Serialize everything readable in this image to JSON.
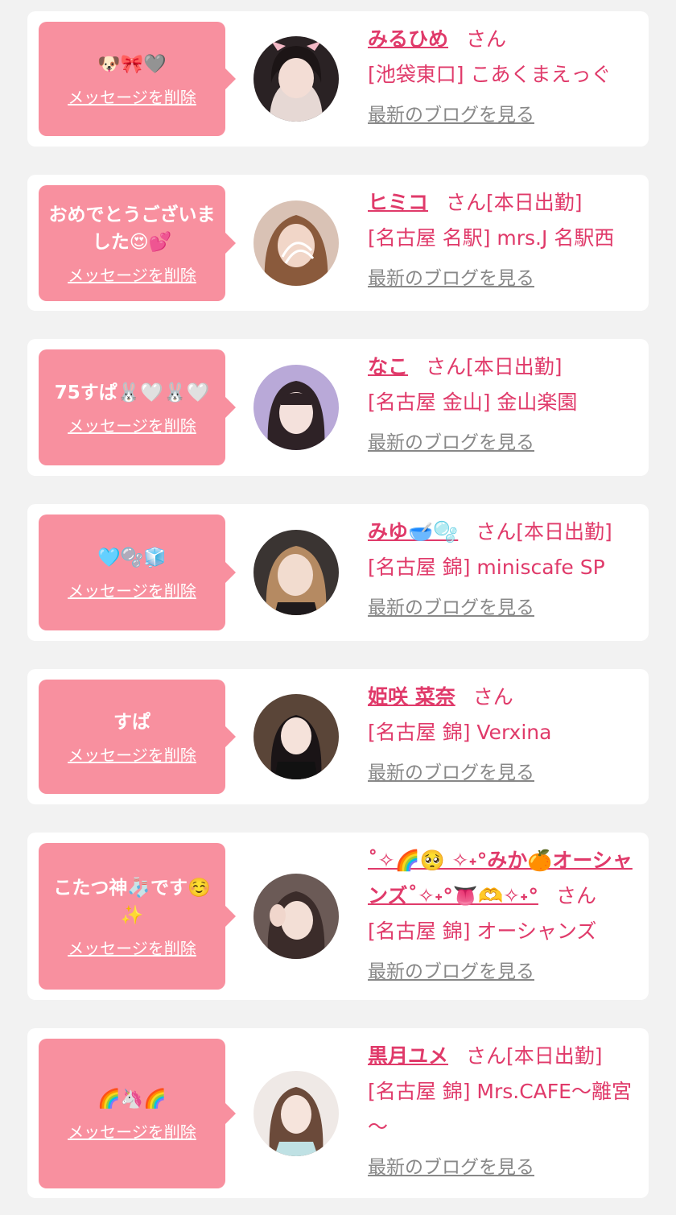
{
  "items": [
    {
      "message": "🐶🎀🩶",
      "delete_label": "メッセージを削除",
      "name": "みるひめ",
      "honorific": "さん",
      "work_status": "",
      "shop": "[池袋東口] こあくまえっぐ",
      "blog_label": "最新のブログを見る"
    },
    {
      "message": "おめでとうございました😍💕",
      "delete_label": "メッセージを削除",
      "name": "ヒミコ",
      "honorific": "さん",
      "work_status": "[本日出勤]",
      "shop": "[名古屋 名駅] mrs.J 名駅西",
      "blog_label": "最新のブログを見る"
    },
    {
      "message": "75すぱ🐰🤍🐰🤍",
      "delete_label": "メッセージを削除",
      "name": "なこ",
      "honorific": "さん",
      "work_status": "[本日出勤]",
      "shop": "[名古屋 金山] 金山楽園",
      "blog_label": "最新のブログを見る"
    },
    {
      "message": "🩵🫧🧊",
      "delete_label": "メッセージを削除",
      "name": "みゆ🥣🫧",
      "honorific": "さん",
      "work_status": "[本日出勤]",
      "shop": "[名古屋 錦] miniscafe SP",
      "blog_label": "最新のブログを見る"
    },
    {
      "message": "すぱ",
      "delete_label": "メッセージを削除",
      "name": "姫咲 菜奈",
      "honorific": "さん",
      "work_status": "",
      "shop": "[名古屋 錦] Verxina",
      "blog_label": "最新のブログを見る"
    },
    {
      "message": "こたつ神🧦です☺️✨",
      "delete_label": "メッセージを削除",
      "name": "˚✧🌈🥺 ✧˖°みか🍊オーシャンズ˚✧˖°👅🫶✧˖°",
      "honorific": "さん",
      "work_status": "",
      "shop": "[名古屋 錦] オーシャンズ",
      "blog_label": "最新のブログを見る"
    },
    {
      "message": "🌈🦄🌈",
      "delete_label": "メッセージを削除",
      "name": "黒月ユメ",
      "honorific": "さん",
      "work_status": "[本日出勤]",
      "shop": "[名古屋 錦] Mrs.CAFE～離宮～",
      "blog_label": "最新のブログを見る"
    }
  ],
  "colors": {
    "bubble": "#f8909f",
    "name": "#e03a6a",
    "link_gray": "#888888",
    "background": "#f2f2f2"
  },
  "icons": {
    "avatar": "profile-photo"
  }
}
